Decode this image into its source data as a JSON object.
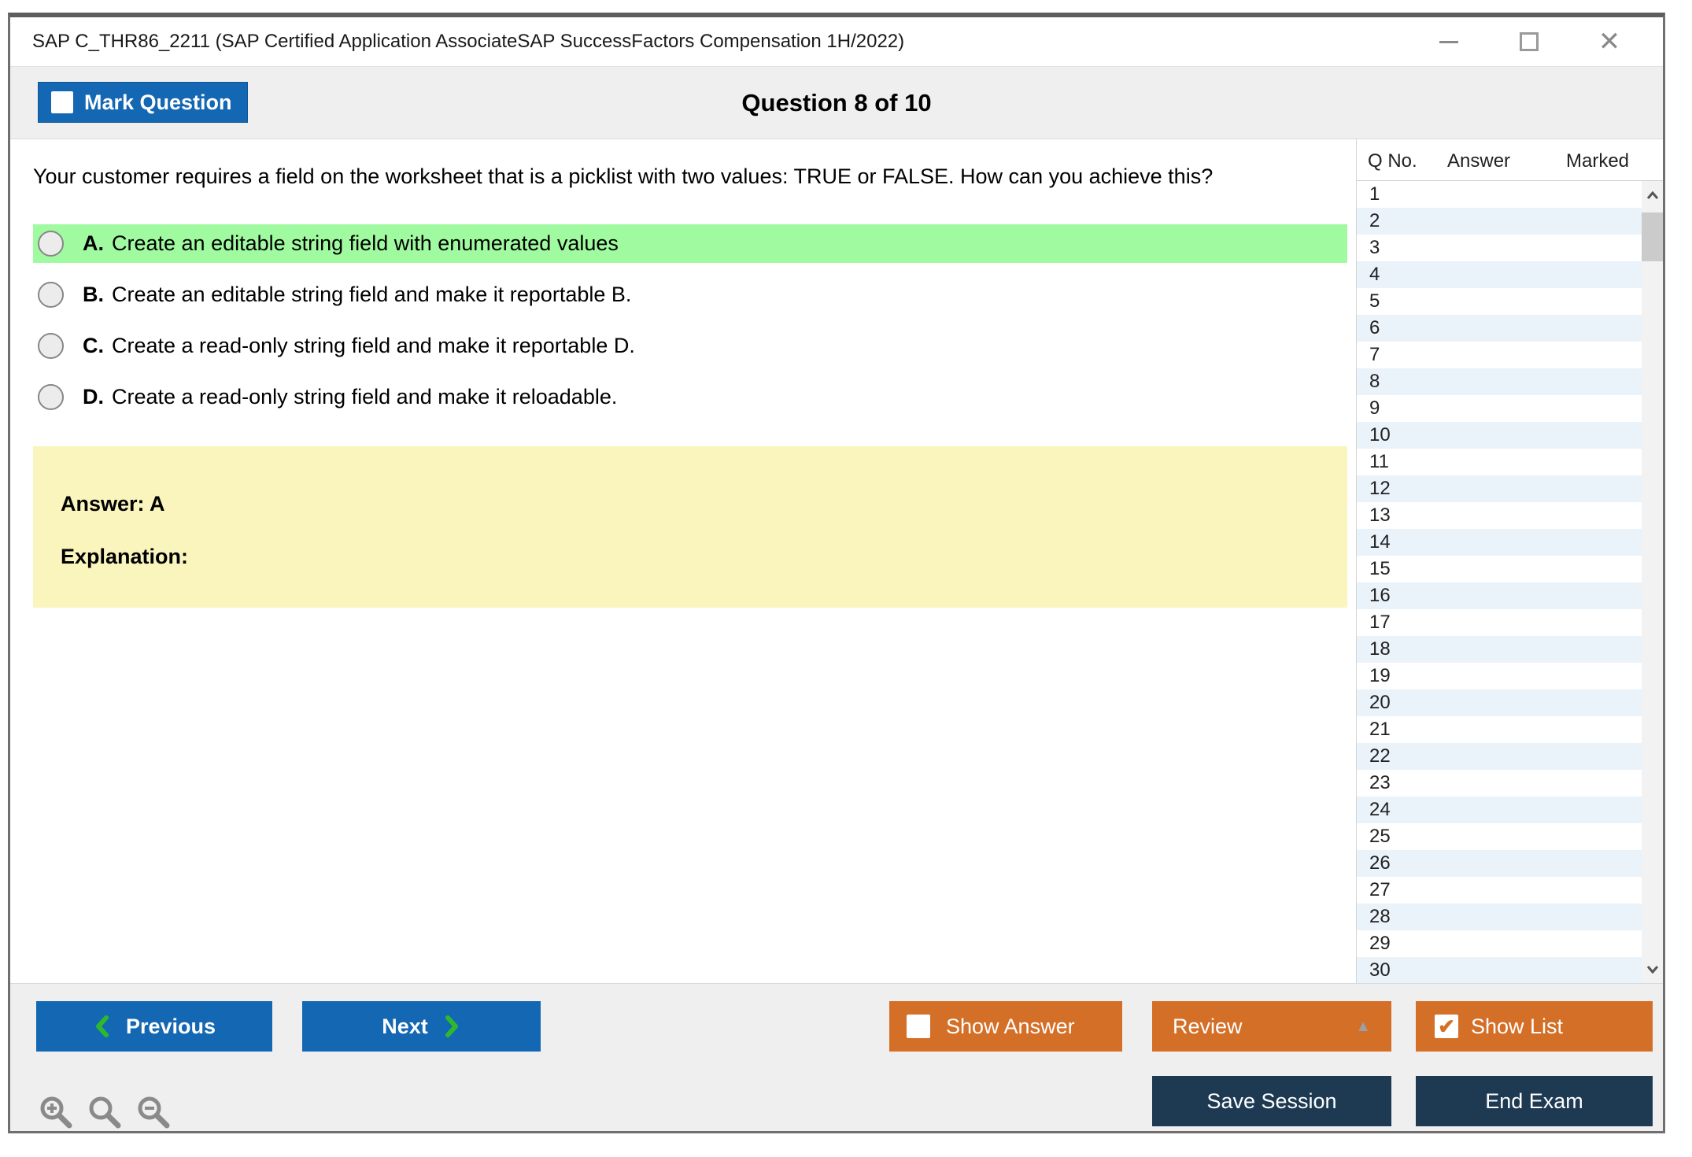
{
  "window": {
    "title": "SAP C_THR86_2211 (SAP Certified Application AssociateSAP SuccessFactors Compensation 1H/2022)"
  },
  "header": {
    "mark_question": "Mark Question",
    "question_counter": "Question 8 of 10"
  },
  "question": {
    "text": "Your customer requires a field on the worksheet that is a picklist with two values: TRUE or FALSE. How can you achieve this?",
    "options": [
      {
        "letter": "A.",
        "text": "Create an editable string field with enumerated values",
        "highlighted": true
      },
      {
        "letter": "B.",
        "text": "Create an editable string field and make it reportable B.",
        "highlighted": false
      },
      {
        "letter": "C.",
        "text": "Create a read-only string field and make it reportable D.",
        "highlighted": false
      },
      {
        "letter": "D.",
        "text": "Create a read-only string field and make it reloadable.",
        "highlighted": false
      }
    ]
  },
  "answer_box": {
    "answer": "Answer: A",
    "explanation": "Explanation:"
  },
  "question_list": {
    "columns": [
      "Q No.",
      "Answer",
      "Marked"
    ],
    "rows": [
      {
        "q": "1",
        "answer": "",
        "marked": ""
      },
      {
        "q": "2",
        "answer": "",
        "marked": ""
      },
      {
        "q": "3",
        "answer": "",
        "marked": ""
      },
      {
        "q": "4",
        "answer": "",
        "marked": ""
      },
      {
        "q": "5",
        "answer": "",
        "marked": ""
      },
      {
        "q": "6",
        "answer": "",
        "marked": ""
      },
      {
        "q": "7",
        "answer": "",
        "marked": ""
      },
      {
        "q": "8",
        "answer": "",
        "marked": ""
      },
      {
        "q": "9",
        "answer": "",
        "marked": ""
      },
      {
        "q": "10",
        "answer": "",
        "marked": ""
      },
      {
        "q": "11",
        "answer": "",
        "marked": ""
      },
      {
        "q": "12",
        "answer": "",
        "marked": ""
      },
      {
        "q": "13",
        "answer": "",
        "marked": ""
      },
      {
        "q": "14",
        "answer": "",
        "marked": ""
      },
      {
        "q": "15",
        "answer": "",
        "marked": ""
      },
      {
        "q": "16",
        "answer": "",
        "marked": ""
      },
      {
        "q": "17",
        "answer": "",
        "marked": ""
      },
      {
        "q": "18",
        "answer": "",
        "marked": ""
      },
      {
        "q": "19",
        "answer": "",
        "marked": ""
      },
      {
        "q": "20",
        "answer": "",
        "marked": ""
      },
      {
        "q": "21",
        "answer": "",
        "marked": ""
      },
      {
        "q": "22",
        "answer": "",
        "marked": ""
      },
      {
        "q": "23",
        "answer": "",
        "marked": ""
      },
      {
        "q": "24",
        "answer": "",
        "marked": ""
      },
      {
        "q": "25",
        "answer": "",
        "marked": ""
      },
      {
        "q": "26",
        "answer": "",
        "marked": ""
      },
      {
        "q": "27",
        "answer": "",
        "marked": ""
      },
      {
        "q": "28",
        "answer": "",
        "marked": ""
      },
      {
        "q": "29",
        "answer": "",
        "marked": ""
      },
      {
        "q": "30",
        "answer": "",
        "marked": ""
      }
    ]
  },
  "footer": {
    "previous": "Previous",
    "next": "Next",
    "show_answer": "Show Answer",
    "review": "Review",
    "show_list": "Show List",
    "save_session": "Save Session",
    "end_exam": "End Exam"
  },
  "colors": {
    "button_blue": "#1467b2",
    "button_orange": "#d46f27",
    "button_navy": "#1d3a52",
    "highlight_green": "#a0fba0",
    "answer_yellow": "#faf4bd",
    "chevron_green": "#2eb82e",
    "row_alt_blue": "#eaf2fa",
    "band_gray": "#efefef"
  }
}
